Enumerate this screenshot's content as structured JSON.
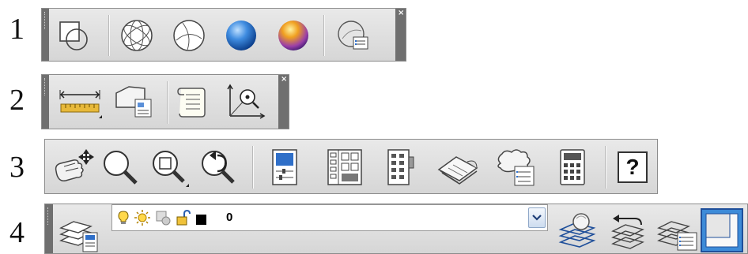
{
  "row_labels": [
    "1",
    "2",
    "3",
    "4"
  ],
  "toolbar1": {
    "close_glyph": "×",
    "icons": [
      "box-with-circle-icon",
      "sphere-wireframe-icon",
      "sphere-hidden-icon",
      "shaded-blue-sphere-icon",
      "realistic-gold-sphere-icon",
      "visual-styles-manager-icon"
    ]
  },
  "toolbar2": {
    "close_glyph": "×",
    "icons": [
      "ruler-measure-icon",
      "boundary-area-icon",
      "scroll-list-icon",
      "locate-point-icon"
    ]
  },
  "toolbar3": {
    "help_label": "?",
    "icons": [
      "pan-hand-icon",
      "zoom-realtime-icon",
      "zoom-window-icon",
      "zoom-previous-icon",
      "properties-palette-icon",
      "design-center-icon",
      "tool-palettes-icon",
      "sheet-set-icon",
      "markup-set-icon",
      "calculator-icon",
      "help-icon"
    ]
  },
  "toolbar4": {
    "layer_value": "0",
    "layer_state_icons": [
      "bulb-on-icon",
      "sun-thaw-icon",
      "viewport-freeze-icon",
      "unlock-icon",
      "color-swatch-icon"
    ],
    "swatch_color": "#000000",
    "icons": [
      "layer-properties-icon",
      "make-current-icon",
      "layer-previous-icon",
      "layer-states-icon",
      "window-icon"
    ]
  }
}
